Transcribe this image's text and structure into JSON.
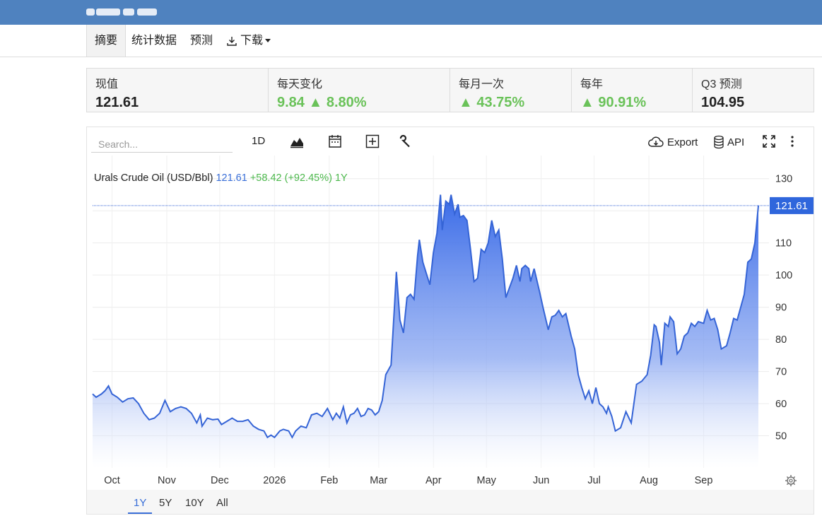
{
  "nav": {
    "tabs": [
      "摘要",
      "统计数据",
      "预测"
    ],
    "download": "下载"
  },
  "stats": [
    {
      "label": "现值",
      "value": "121.61",
      "value_class": ""
    },
    {
      "label": "每天变化",
      "value": "9.84 ▲ 8.80%",
      "value_class": "green"
    },
    {
      "label": "每月一次",
      "value": "▲ 43.75%",
      "value_class": "green"
    },
    {
      "label": "每年",
      "value": "▲ 90.91%",
      "value_class": "green"
    },
    {
      "label": "Q3 预测",
      "value": "104.95",
      "value_class": ""
    }
  ],
  "toolbar": {
    "search_placeholder": "Search...",
    "interval": "1D",
    "export": "Export",
    "api": "API"
  },
  "legend": {
    "name": "Urals Crude Oil (USD/Bbl)",
    "price": "121.61",
    "change": "+58.42",
    "pct": "(+92.45%)",
    "period": "1Y"
  },
  "ranges": [
    "1Y",
    "5Y",
    "10Y",
    "All"
  ],
  "colors": {
    "accent": "#3a6fd8",
    "green": "#6ac259",
    "topbar": "#4f82bf",
    "line": "#3564d6"
  },
  "chart_data": {
    "type": "area",
    "series_name": "Urals Crude Oil (USD/Bbl)",
    "ylim": [
      40,
      135
    ],
    "yticks": [
      50,
      60,
      70,
      80,
      90,
      100,
      110,
      120,
      130
    ],
    "ytick_labels": [
      "50",
      "60",
      "70",
      "80",
      "90",
      "100",
      "110",
      "",
      "130"
    ],
    "current_value": 121.61,
    "xtick_labels": [
      "Oct",
      "Nov",
      "Dec",
      "2026",
      "Feb",
      "Mar",
      "Apr",
      "May",
      "Jun",
      "Jul",
      "Aug",
      "Sep"
    ],
    "xtick_dates": [
      "2025-10-01",
      "2025-11-01",
      "2025-12-01",
      "2026-01-01",
      "2026-02-01",
      "2026-03-01",
      "2026-04-01",
      "2026-05-01",
      "2026-06-01",
      "2026-07-01",
      "2026-08-01",
      "2026-09-01"
    ],
    "grid": true,
    "points": [
      [
        "2025-09-20",
        63
      ],
      [
        "2025-09-22",
        62
      ],
      [
        "2025-09-25",
        63
      ],
      [
        "2025-09-27",
        64
      ],
      [
        "2025-09-29",
        65.5
      ],
      [
        "2025-10-01",
        63
      ],
      [
        "2025-10-04",
        62
      ],
      [
        "2025-10-07",
        60.5
      ],
      [
        "2025-10-10",
        61.5
      ],
      [
        "2025-10-13",
        61.8
      ],
      [
        "2025-10-16",
        60
      ],
      [
        "2025-10-19",
        57
      ],
      [
        "2025-10-22",
        55
      ],
      [
        "2025-10-25",
        55.5
      ],
      [
        "2025-10-28",
        57
      ],
      [
        "2025-10-31",
        61
      ],
      [
        "2025-11-03",
        57.5
      ],
      [
        "2025-11-06",
        58.5
      ],
      [
        "2025-11-09",
        59
      ],
      [
        "2025-11-12",
        58.5
      ],
      [
        "2025-11-15",
        57
      ],
      [
        "2025-11-18",
        54
      ],
      [
        "2025-11-20",
        56.5
      ],
      [
        "2025-11-21",
        53
      ],
      [
        "2025-11-24",
        55.5
      ],
      [
        "2025-11-27",
        55
      ],
      [
        "2025-11-30",
        55.2
      ],
      [
        "2025-12-02",
        53.5
      ],
      [
        "2025-12-05",
        54.5
      ],
      [
        "2025-12-08",
        55.5
      ],
      [
        "2025-12-11",
        54.5
      ],
      [
        "2025-12-14",
        54.5
      ],
      [
        "2025-12-17",
        55
      ],
      [
        "2025-12-20",
        53
      ],
      [
        "2025-12-23",
        52
      ],
      [
        "2025-12-26",
        51.5
      ],
      [
        "2025-12-28",
        49.5
      ],
      [
        "2025-12-30",
        50.2
      ],
      [
        "2026-01-01",
        49.5
      ],
      [
        "2026-01-04",
        51.5
      ],
      [
        "2026-01-06",
        52
      ],
      [
        "2026-01-09",
        51.5
      ],
      [
        "2026-01-11",
        49.5
      ],
      [
        "2026-01-13",
        51.5
      ],
      [
        "2026-01-16",
        53
      ],
      [
        "2026-01-19",
        52.5
      ],
      [
        "2026-01-22",
        56.5
      ],
      [
        "2026-01-25",
        57
      ],
      [
        "2026-01-28",
        56
      ],
      [
        "2026-01-31",
        58.5
      ],
      [
        "2026-02-03",
        55
      ],
      [
        "2026-02-05",
        57
      ],
      [
        "2026-02-07",
        55.5
      ],
      [
        "2026-02-09",
        59
      ],
      [
        "2026-02-11",
        54
      ],
      [
        "2026-02-13",
        56.5
      ],
      [
        "2026-02-15",
        57
      ],
      [
        "2026-02-17",
        58.5
      ],
      [
        "2026-02-19",
        56
      ],
      [
        "2026-02-21",
        56.5
      ],
      [
        "2026-02-23",
        58.5
      ],
      [
        "2026-02-25",
        58
      ],
      [
        "2026-02-27",
        56.5
      ],
      [
        "2026-03-01",
        57.5
      ],
      [
        "2026-03-03",
        61
      ],
      [
        "2026-03-05",
        69
      ],
      [
        "2026-03-08",
        72
      ],
      [
        "2026-03-10",
        91
      ],
      [
        "2026-03-11",
        101
      ],
      [
        "2026-03-13",
        86
      ],
      [
        "2026-03-15",
        82
      ],
      [
        "2026-03-17",
        93
      ],
      [
        "2026-03-19",
        94
      ],
      [
        "2026-03-21",
        92.5
      ],
      [
        "2026-03-23",
        106
      ],
      [
        "2026-03-24",
        111
      ],
      [
        "2026-03-26",
        104
      ],
      [
        "2026-03-28",
        100.5
      ],
      [
        "2026-03-30",
        97
      ],
      [
        "2026-04-01",
        107
      ],
      [
        "2026-04-03",
        113
      ],
      [
        "2026-04-05",
        125
      ],
      [
        "2026-04-06",
        114
      ],
      [
        "2026-04-08",
        123
      ],
      [
        "2026-04-10",
        122
      ],
      [
        "2026-04-11",
        125
      ],
      [
        "2026-04-13",
        119
      ],
      [
        "2026-04-15",
        122
      ],
      [
        "2026-04-16",
        118
      ],
      [
        "2026-04-18",
        118.5
      ],
      [
        "2026-04-20",
        117
      ],
      [
        "2026-04-22",
        108
      ],
      [
        "2026-04-24",
        98
      ],
      [
        "2026-04-26",
        99
      ],
      [
        "2026-04-28",
        108
      ],
      [
        "2026-04-30",
        107
      ],
      [
        "2026-05-02",
        110
      ],
      [
        "2026-05-04",
        117
      ],
      [
        "2026-05-06",
        112
      ],
      [
        "2026-05-08",
        114
      ],
      [
        "2026-05-10",
        105
      ],
      [
        "2026-05-12",
        93
      ],
      [
        "2026-05-14",
        96
      ],
      [
        "2026-05-16",
        99
      ],
      [
        "2026-05-18",
        103
      ],
      [
        "2026-05-20",
        98
      ],
      [
        "2026-05-21",
        102
      ],
      [
        "2026-05-23",
        103
      ],
      [
        "2026-05-25",
        102
      ],
      [
        "2026-05-26",
        98
      ],
      [
        "2026-05-28",
        102
      ],
      [
        "2026-05-31",
        95
      ],
      [
        "2026-06-02",
        90
      ],
      [
        "2026-06-05",
        83
      ],
      [
        "2026-06-07",
        87
      ],
      [
        "2026-06-09",
        87.5
      ],
      [
        "2026-06-11",
        89
      ],
      [
        "2026-06-13",
        87
      ],
      [
        "2026-06-15",
        88
      ],
      [
        "2026-06-18",
        81
      ],
      [
        "2026-06-20",
        77
      ],
      [
        "2026-06-22",
        69
      ],
      [
        "2026-06-24",
        65
      ],
      [
        "2026-06-26",
        61.5
      ],
      [
        "2026-06-28",
        64
      ],
      [
        "2026-06-30",
        60
      ],
      [
        "2026-07-02",
        65
      ],
      [
        "2026-07-04",
        60
      ],
      [
        "2026-07-06",
        59
      ],
      [
        "2026-07-08",
        57
      ],
      [
        "2026-07-09",
        59
      ],
      [
        "2026-07-11",
        56
      ],
      [
        "2026-07-13",
        51.5
      ],
      [
        "2026-07-16",
        52.5
      ],
      [
        "2026-07-19",
        57.5
      ],
      [
        "2026-07-22",
        54
      ],
      [
        "2026-07-25",
        66
      ],
      [
        "2026-07-28",
        67
      ],
      [
        "2026-07-31",
        69
      ],
      [
        "2026-08-02",
        75
      ],
      [
        "2026-08-04",
        84.5
      ],
      [
        "2026-08-05",
        84
      ],
      [
        "2026-08-07",
        79
      ],
      [
        "2026-08-08",
        72
      ],
      [
        "2026-08-10",
        85
      ],
      [
        "2026-08-12",
        84
      ],
      [
        "2026-08-13",
        87
      ],
      [
        "2026-08-15",
        85.5
      ],
      [
        "2026-08-17",
        75.5
      ],
      [
        "2026-08-19",
        77
      ],
      [
        "2026-08-21",
        81
      ],
      [
        "2026-08-23",
        82
      ],
      [
        "2026-08-25",
        85
      ],
      [
        "2026-08-27",
        84
      ],
      [
        "2026-08-29",
        85.5
      ],
      [
        "2026-09-01",
        85
      ],
      [
        "2026-09-03",
        89
      ],
      [
        "2026-09-05",
        86
      ],
      [
        "2026-09-07",
        86.5
      ],
      [
        "2026-09-09",
        83
      ],
      [
        "2026-09-11",
        77
      ],
      [
        "2026-09-14",
        78
      ],
      [
        "2026-09-16",
        82
      ],
      [
        "2026-09-18",
        86.5
      ],
      [
        "2026-09-20",
        86
      ],
      [
        "2026-09-22",
        90
      ],
      [
        "2026-09-24",
        94
      ],
      [
        "2026-09-26",
        104
      ],
      [
        "2026-09-28",
        105
      ],
      [
        "2026-09-30",
        110
      ],
      [
        "2026-10-02",
        121.61
      ]
    ]
  }
}
